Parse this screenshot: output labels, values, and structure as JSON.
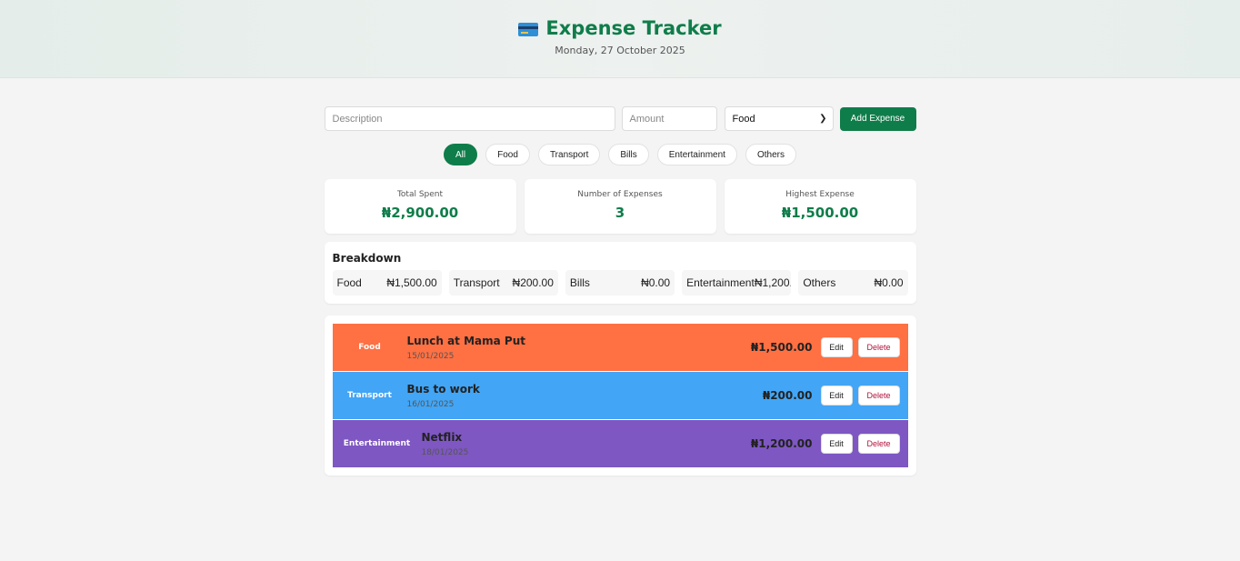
{
  "header": {
    "icon": "credit-card-icon",
    "title": "Expense Tracker",
    "date": "Monday, 27 October 2025"
  },
  "form": {
    "description_placeholder": "Description",
    "amount_placeholder": "Amount",
    "category_selected": "Food",
    "add_label": "Add Expense"
  },
  "filters": [
    "All",
    "Food",
    "Transport",
    "Bills",
    "Entertainment",
    "Others"
  ],
  "active_filter": "All",
  "stats": {
    "total_label": "Total Spent",
    "total_value": "₦2,900.00",
    "count_label": "Number of Expenses",
    "count_value": "3",
    "highest_label": "Highest Expense",
    "highest_value": "₦1,500.00"
  },
  "breakdown": {
    "title": "Breakdown",
    "items": [
      {
        "name": "Food",
        "amount": "₦1,500.00"
      },
      {
        "name": "Transport",
        "amount": "₦200.00"
      },
      {
        "name": "Bills",
        "amount": "₦0.00"
      },
      {
        "name": "Entertainment",
        "amount": "₦1,200.00"
      },
      {
        "name": "Others",
        "amount": "₦0.00"
      }
    ]
  },
  "expenses": [
    {
      "category": "Food",
      "description": "Lunch at Mama Put",
      "date": "15/01/2025",
      "amount": "₦1,500.00",
      "color": "#ff7043"
    },
    {
      "category": "Transport",
      "description": "Bus to work",
      "date": "16/01/2025",
      "amount": "₦200.00",
      "color": "#42a5f5"
    },
    {
      "category": "Entertainment",
      "description": "Netflix",
      "date": "18/01/2025",
      "amount": "₦1,200.00",
      "color": "#7e57c2"
    }
  ],
  "actions": {
    "edit": "Edit",
    "delete": "Delete"
  },
  "colors": {
    "brand": "#0f7d4a",
    "delete": "#b3123b"
  }
}
